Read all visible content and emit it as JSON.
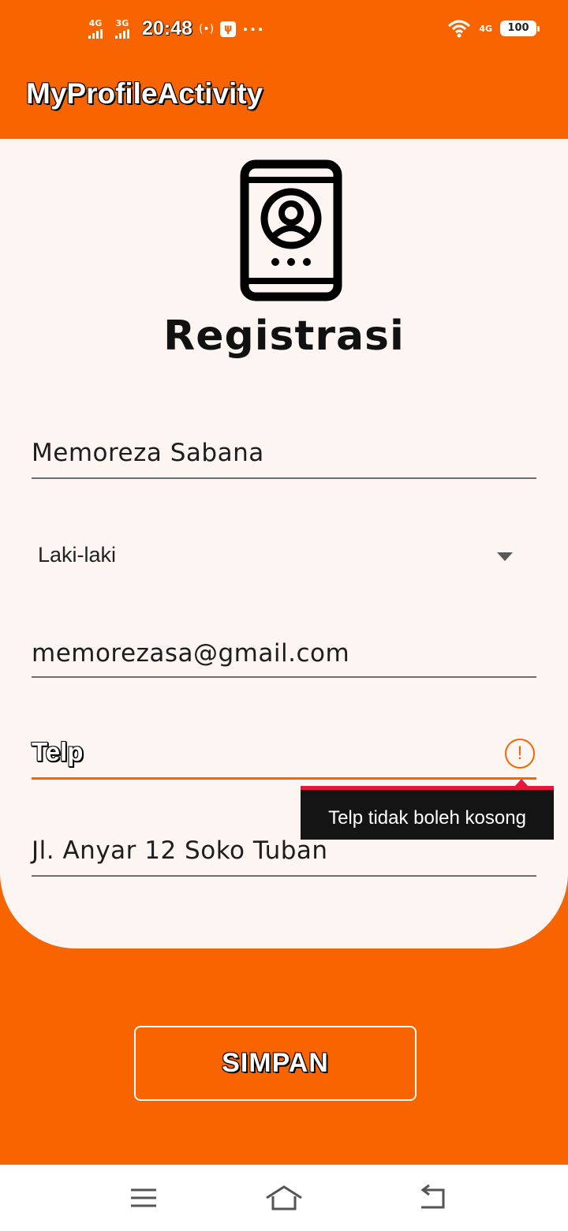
{
  "status_bar": {
    "signal1": "4G",
    "signal2": "3G",
    "time": "20:48",
    "lte": "4G",
    "battery": "100"
  },
  "app_bar": {
    "title": "MyProfileActivity"
  },
  "form": {
    "heading": "Registrasi",
    "name_value": "Memoreza Sabana",
    "gender_selected": "Laki-laki",
    "email_value": "memorezasa@gmail.com",
    "telp_hint": "Telp",
    "telp_error": "Telp tidak boleh kosong",
    "address_value": "Jl. Anyar 12 Soko Tuban"
  },
  "actions": {
    "save_label": "SIMPAN"
  },
  "colors": {
    "primary": "#f86400",
    "card": "#fcf5f2",
    "error_accent": "#e8153d"
  },
  "icons": [
    "profile-phone-icon",
    "error-icon",
    "dropdown-arrow-icon",
    "menu-icon",
    "home-icon",
    "back-icon",
    "wifi-icon",
    "battery-icon"
  ]
}
